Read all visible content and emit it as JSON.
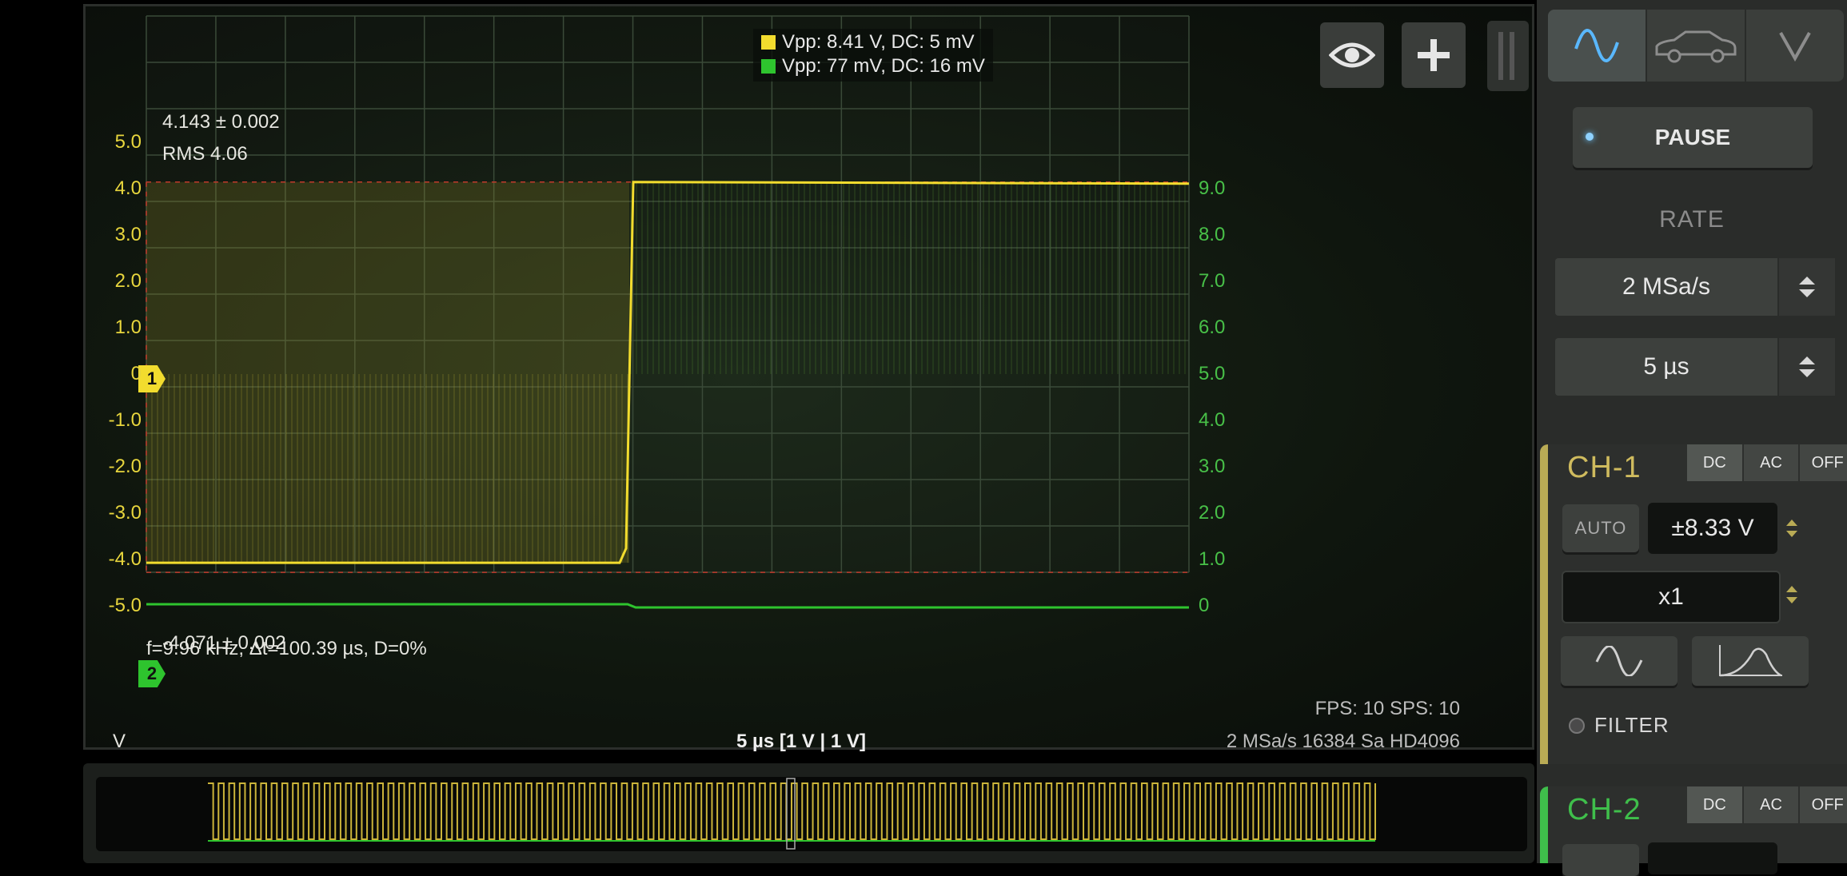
{
  "scope": {
    "y_axis_left": [
      "5.0",
      "4.0",
      "3.0",
      "2.0",
      "1.0",
      "0",
      "-1.0",
      "-2.0",
      "-3.0",
      "-4.0",
      "-5.0"
    ],
    "y_axis_right": [
      "9.0",
      "8.0",
      "7.0",
      "6.0",
      "5.0",
      "4.0",
      "3.0",
      "2.0",
      "1.0",
      "0"
    ],
    "unit_label": "V",
    "legend": [
      {
        "text": "Vpp: 8.41 V, DC: 5 mV",
        "color": "#f2dc2e"
      },
      {
        "text": "Vpp: 77 mV, DC: 16 mV",
        "color": "#2ec42e"
      }
    ],
    "measurements": {
      "high": "4.143 ± 0.002",
      "rms": "RMS 4.06",
      "low": "-4.071 ± 0.002",
      "freq": "f=9.96 kHz, Δt=100.39 µs, D=0%"
    },
    "channel_markers": {
      "ch1": "1",
      "ch2": "2"
    },
    "status": {
      "fps": "FPS: 10  SPS: 10",
      "acq": "2 MSa/s   16384 Sa   HD4096"
    },
    "timebase_label": "5 µs  [1 V | 1 V]",
    "overlay_buttons": {
      "eye": "eye-icon",
      "add": "plus-icon"
    },
    "colors": {
      "ch1": "#f2dc2e",
      "ch2": "#2ec42e",
      "grid": "#3a4a38"
    }
  },
  "panel": {
    "modes": [
      "wave-icon",
      "car-icon",
      "voltmeter-icon"
    ],
    "pause_label": "PAUSE",
    "rate_label": "RATE",
    "rate_value": "2 MSa/s",
    "timebase_value": "5 µs",
    "ch1": {
      "title": "CH-1",
      "coupling": [
        "DC",
        "AC",
        "OFF"
      ],
      "auto_label": "AUTO",
      "range": "±8.33 V",
      "probe": "x1",
      "filter_label": "FILTER"
    },
    "ch2": {
      "title": "CH-2",
      "coupling": [
        "DC",
        "AC",
        "OFF"
      ]
    }
  }
}
